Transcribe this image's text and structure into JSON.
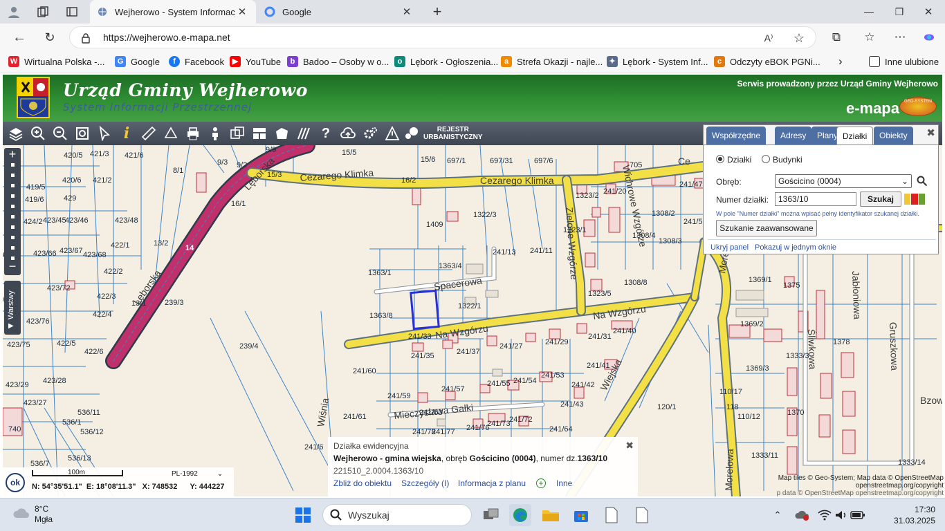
{
  "browser": {
    "tabs": [
      {
        "title": "Wejherowo - System Informacji Przestrzennej",
        "active": true,
        "close": "✕"
      },
      {
        "title": "Google",
        "active": false,
        "close": "✕"
      }
    ],
    "new_tab": "+",
    "url": "https://wejherowo.e-mapa.net",
    "window_controls": [
      "—",
      "❐",
      "✕"
    ],
    "favorites": [
      {
        "label": "Wirtualna Polska -...",
        "icon": "W",
        "color": "#e3222f"
      },
      {
        "label": "Google",
        "icon": "G",
        "color": "#4285f4"
      },
      {
        "label": "Facebook",
        "icon": "f",
        "color": "#1877f2"
      },
      {
        "label": "YouTube",
        "icon": "▶",
        "color": "#ff0000"
      },
      {
        "label": "Badoo – Osoby w o...",
        "icon": "b",
        "color": "#7a3fd0"
      },
      {
        "label": "Lębork - Ogłoszenia...",
        "icon": "o",
        "color": "#0e8a7a"
      },
      {
        "label": "Strefa Okazji - najle...",
        "icon": "a",
        "color": "#f08a00"
      },
      {
        "label": "Lębork - System Inf...",
        "icon": "✦",
        "color": "#5a6a8a"
      },
      {
        "label": "Odczyty eBOK PGNi...",
        "icon": "c",
        "color": "#e07a10"
      }
    ],
    "favorites_more": "›",
    "other_favorites": "Inne ulubione"
  },
  "header": {
    "title": "Urząd Gminy Wejherowo",
    "subtitle": "System Informacji Przestrzennej",
    "provider": "Serwis prowadzony przez Urząd Gminy Wejherowo",
    "brand": "e-mapa",
    "brand_logo_text": "GEO-SYSTEM"
  },
  "toolbar": {
    "rejestr": "REJESTR",
    "rejestr2": "URBANISTYCZNY"
  },
  "map": {
    "streets": [
      "Lęborska",
      "Lęborska",
      "Cezarego Klimka",
      "Cezarego Klimka",
      "Spacerowa",
      "Na Wzgórzu",
      "Na Wzgórzu",
      "Zielone Wzgórze",
      "Wichrowe Wzgórze",
      "Mieczysława Gałki",
      "Wiejska",
      "Jabłoniowa",
      "Gruszkowa",
      "Śliwkowa",
      "Morelowa",
      "Wiśnia",
      "Bzowa",
      "Ce",
      "Morelowa"
    ],
    "road_numbers": [
      "14"
    ],
    "parcels": [
      "420/5",
      "421/3",
      "421/6",
      "419/5",
      "419/6",
      "420/6",
      "421/2",
      "429",
      "424/2",
      "423/45",
      "423/46",
      "423/48",
      "423/67",
      "422/1",
      "423/66",
      "423/68",
      "422/2",
      "423/72",
      "422/3",
      "422/4",
      "423/76",
      "422/5",
      "423/75",
      "422/6",
      "423/29",
      "423/28",
      "423/27",
      "536/11",
      "536/1",
      "536/12",
      "536/13",
      "536/7",
      "740",
      "8/1",
      "9/3",
      "9/2",
      "9/9",
      "15/5",
      "15/3",
      "16/1",
      "16/2",
      "15/6",
      "697/1",
      "697/31",
      "697/6",
      "1409",
      "1322/3",
      "1363/1",
      "1363/4",
      "1322/1",
      "1363/8",
      "241/13",
      "241/11",
      "241/33",
      "241/35",
      "241/37",
      "241/27",
      "241/29",
      "241/31",
      "241/40",
      "241/60",
      "241/41",
      "241/42",
      "241/43",
      "241/57",
      "241/55",
      "241/54",
      "241/53",
      "241/59",
      "241/61",
      "241/63",
      "241/78",
      "241/77",
      "241/76",
      "241/73",
      "241/72",
      "241/64",
      "241/6",
      "239/4",
      "239/3",
      "13/1",
      "13/2",
      "1323/2",
      "241/20",
      "1323/1",
      "1308/4",
      "1308/2",
      "1308/3",
      "1308/8",
      "1323/5",
      "241/47",
      "241/5",
      "1369/1",
      "1375",
      "1369/2",
      "1369/3",
      "1378",
      "1333/3",
      "110/17",
      "118",
      "110/12",
      "1370",
      "120/1",
      "1333/11",
      "1333/14",
      "/71",
      "65",
      "705"
    ]
  },
  "panel": {
    "tabs": [
      "Współrzędne",
      "Adresy",
      "Plany",
      "Działki",
      "Obiekty"
    ],
    "active_tab": "Działki",
    "close": "✖",
    "radio_dzialki": "Działki",
    "radio_budynki": "Budynki",
    "obreb_label": "Obręb:",
    "obreb_value": "Gościcino (0004)",
    "numer_label": "Numer działki:",
    "numer_value": "1363/10",
    "search_button": "Szukaj",
    "hint": "W pole \"Numer działki\" można wpisać pełny identyfikator szukanej działki.",
    "advanced_button": "Szukanie zaawansowane",
    "hide_panel": "Ukryj panel",
    "single_window": "Pokazuj w jednym oknie"
  },
  "info": {
    "type": "Działka ewidencyjna",
    "place": "Wejherowo - gmina wiejska",
    "obreb_pre": ", obręb ",
    "obreb": "Gościcino (0004)",
    "numer_pre": ", numer dz.",
    "numer": "1363/10",
    "id": "221510_2.0004.1363/10",
    "links": [
      "Zbliż do obiektu",
      "Szczegóły (I)",
      "Informacja z planu",
      "Inne"
    ],
    "close": "✖"
  },
  "scale": {
    "ok": "ok",
    "scale_label": "100m",
    "crs": "PL-1992",
    "coords": "N: 54°35'51.1\"  E: 18°08'11.3\"   X: 748532      Y: 444227"
  },
  "attribution": {
    "line1": "Map tiles © Geo-System; Map data © OpenStreetMap",
    "line2": "openstreetmap.org/copyright",
    "line3": "p data © OpenStreetMap openstreetmap.org/copyright"
  },
  "side": {
    "zoom_in": "+",
    "zoom_out": "−",
    "layers": "Warstwy"
  },
  "taskbar": {
    "temp": "8°C",
    "weather": "Mgła",
    "search_placeholder": "Wyszukaj",
    "time": "17:30",
    "date": "31.03.2025"
  }
}
